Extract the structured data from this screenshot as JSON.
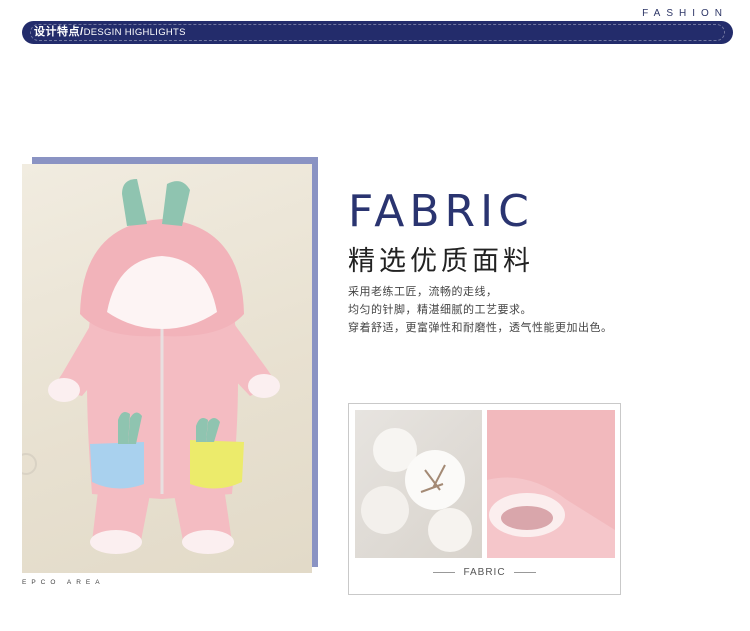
{
  "header": {
    "fashion_label": "FASHION",
    "banner_cn": "设计特点/",
    "banner_en": "DESGIN HIGHLIGHTS"
  },
  "left_photo": {
    "caption": "EPCO AREA",
    "frame_color": "#8a93c3"
  },
  "fabric": {
    "title": "FABRIC",
    "subtitle": "精选优质面料",
    "description": [
      "采用老练工匠，流畅的走线，",
      "均匀的针脚，精湛细腻的工艺要求。",
      "穿着舒适，更富弹性和耐磨性，透气性能更加出色。"
    ]
  },
  "detail_box": {
    "caption": "FABRIC"
  },
  "colors": {
    "brand_navy": "#232c6b",
    "romper_pink": "#f4bcc2",
    "pocket_blue": "#a9d1ee",
    "pocket_yellow": "#eceb6b",
    "ear_green": "#8fc4b0"
  }
}
